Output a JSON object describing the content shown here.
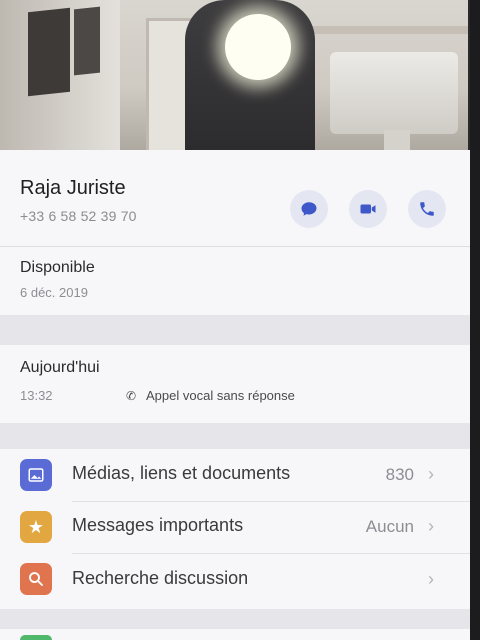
{
  "contact": {
    "name": "Raja Juriste",
    "phone": "+33 6 58 52 39 70"
  },
  "status": {
    "label": "Disponible",
    "date": "6 déc. 2019"
  },
  "calls": {
    "day": "Aujourd'hui",
    "time": "13:32",
    "description": "Appel vocal sans réponse"
  },
  "menu": [
    {
      "label": "Médias, liens et documents",
      "value": "830",
      "icon": "photo-icon",
      "color": "#5b6bd6"
    },
    {
      "label": "Messages importants",
      "value": "Aucun",
      "icon": "star-icon",
      "color": "#e3a742"
    },
    {
      "label": "Recherche discussion",
      "value": "",
      "icon": "search-icon",
      "color": "#e0744e"
    }
  ],
  "colors": {
    "accent": "#3e58c9",
    "background": "#f2f1f4"
  }
}
